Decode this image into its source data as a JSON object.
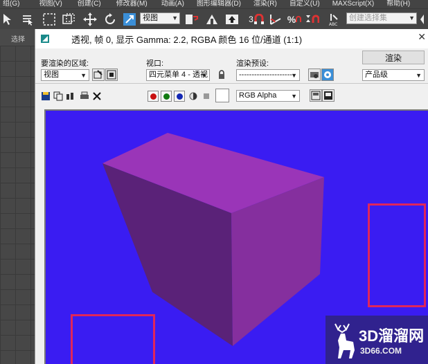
{
  "menubar": [
    "组(G)",
    "视图(V)",
    "创建(C)",
    "修改器(M)",
    "动画(A)",
    "图形编辑器(D)",
    "渲染(R)",
    "自定义(U)",
    "MAXScript(X)",
    "帮助(H)"
  ],
  "toolbar": {
    "view_dropdown": "视图",
    "selection_set_dropdown": "创建选择集",
    "snap_number": "3"
  },
  "left_panel": {
    "tab_label": "选择"
  },
  "render_window": {
    "title": "透视, 帧 0, 显示 Gamma: 2.2, RGBA 颜色 16 位/通道 (1:1)",
    "close_glyph": "✕",
    "area_label": "要渲染的区域:",
    "area_value": "视图",
    "viewport_label": "视口:",
    "viewport_value": "四元菜单 4 - 透视",
    "preset_label": "渲染预设:",
    "preset_value": "---------------------",
    "render_button": "渲染",
    "quality_value": "产品级",
    "channel_value": "RGB Alpha"
  },
  "colors": {
    "canvas_bg": "#3a1cf2",
    "box_top": "#9a35b8",
    "box_front": "#852f9e",
    "box_side": "#5a2278",
    "annotation": "#e0265a"
  },
  "watermark": {
    "brand": "3D溜溜网",
    "domain": "3D66.COM"
  }
}
